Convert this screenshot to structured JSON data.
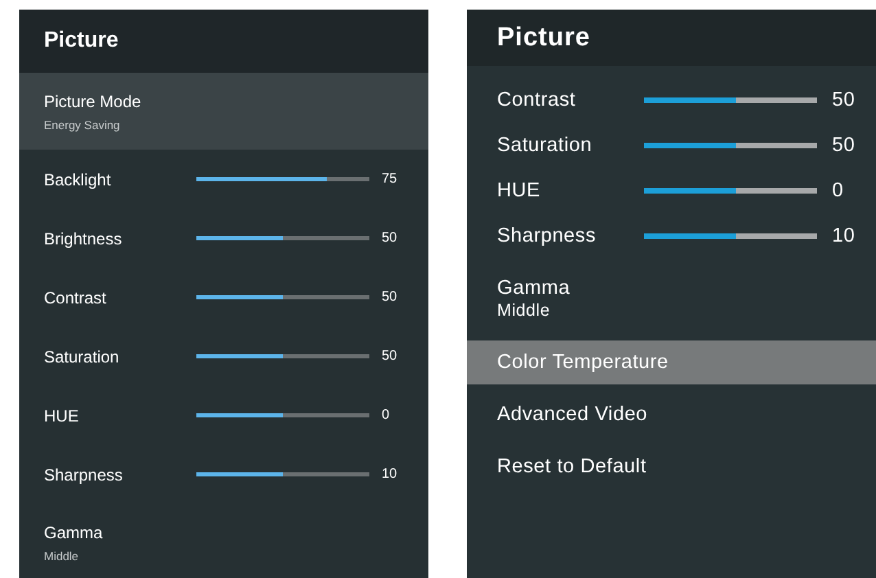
{
  "panels": [
    {
      "title": "Picture",
      "items": [
        {
          "kind": "option",
          "label": "Picture Mode",
          "value": "Energy Saving",
          "selected": true
        },
        {
          "kind": "slider",
          "label": "Backlight",
          "level": 0.75,
          "reading": "75",
          "selected": false
        },
        {
          "kind": "slider",
          "label": "Brightness",
          "level": 0.5,
          "reading": "50",
          "selected": false
        },
        {
          "kind": "slider",
          "label": "Contrast",
          "level": 0.5,
          "reading": "50",
          "selected": false
        },
        {
          "kind": "slider",
          "label": "Saturation",
          "level": 0.5,
          "reading": "50",
          "selected": false
        },
        {
          "kind": "slider",
          "label": "HUE",
          "level": 0.5,
          "reading": "0",
          "selected": false
        },
        {
          "kind": "slider",
          "label": "Sharpness",
          "level": 0.5,
          "reading": "10",
          "selected": false
        },
        {
          "kind": "option",
          "label": "Gamma",
          "value": "Middle",
          "selected": false
        }
      ]
    },
    {
      "title": "Picture",
      "items": [
        {
          "kind": "slider",
          "label": "Contrast",
          "level": 0.53,
          "reading": "50",
          "selected": false
        },
        {
          "kind": "slider",
          "label": "Saturation",
          "level": 0.53,
          "reading": "50",
          "selected": false
        },
        {
          "kind": "slider",
          "label": "HUE",
          "level": 0.53,
          "reading": "0",
          "selected": false
        },
        {
          "kind": "slider",
          "label": "Sharpness",
          "level": 0.53,
          "reading": "10",
          "selected": false
        },
        {
          "kind": "option",
          "label": "Gamma",
          "value": "Middle",
          "selected": false
        },
        {
          "kind": "action",
          "label": "Color Temperature",
          "selected": true
        },
        {
          "kind": "action",
          "label": "Advanced Video",
          "selected": false
        },
        {
          "kind": "action",
          "label": "Reset to Default",
          "selected": false
        }
      ]
    }
  ]
}
